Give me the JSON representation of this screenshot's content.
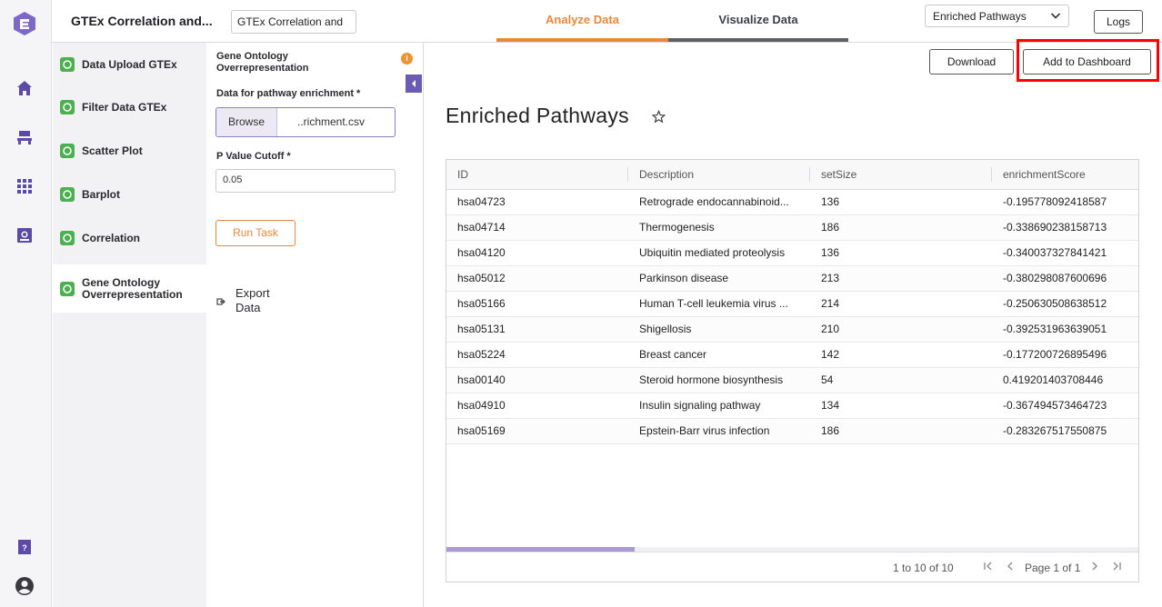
{
  "rail": {
    "icons": [
      "logo-icon",
      "home-icon",
      "workflow-icon",
      "apps-icon",
      "analysis-icon",
      "help-icon",
      "user-icon"
    ],
    "help_label": "?"
  },
  "header": {
    "app_title": "GTEx Correlation and...",
    "project_name": "GTEx Correlation and",
    "tabs": [
      {
        "label": "Analyze Data",
        "active": true
      },
      {
        "label": "Visualize Data",
        "active": false
      }
    ],
    "view_select": "Enriched Pathways",
    "logs_label": "Logs"
  },
  "steps": [
    {
      "label": "Data Upload GTEx",
      "done": true
    },
    {
      "label": "Filter Data GTEx",
      "done": true
    },
    {
      "label": "Scatter Plot",
      "done": true
    },
    {
      "label": "Barplot",
      "done": true
    },
    {
      "label": "Correlation",
      "done": true
    },
    {
      "label": "Gene Ontology Overrepresentation",
      "done": true,
      "active": true
    }
  ],
  "settings": {
    "title": "Gene Ontology Overrepresentation",
    "info_label": "i",
    "data_label": "Data for pathway enrichment *",
    "browse_label": "Browse",
    "file_name": "..richment.csv",
    "pvalue_label": "P Value Cutoff *",
    "pvalue_value": "0.05",
    "run_label": "Run Task",
    "export_label": "Export Data"
  },
  "main": {
    "download_label": "Download",
    "dashboard_label": "Add to Dashboard",
    "title": "Enriched Pathways",
    "columns": [
      "ID",
      "Description",
      "setSize",
      "enrichmentScore"
    ],
    "rows": [
      [
        "hsa04723",
        "Retrograde endocannabinoid...",
        "136",
        "-0.195778092418587"
      ],
      [
        "hsa04714",
        "Thermogenesis",
        "186",
        "-0.338690238158713"
      ],
      [
        "hsa04120",
        "Ubiquitin mediated proteolysis",
        "136",
        "-0.340037327841421"
      ],
      [
        "hsa05012",
        "Parkinson disease",
        "213",
        "-0.380298087600696"
      ],
      [
        "hsa05166",
        "Human T-cell leukemia virus ...",
        "214",
        "-0.250630508638512"
      ],
      [
        "hsa05131",
        "Shigellosis",
        "210",
        "-0.392531963639051"
      ],
      [
        "hsa05224",
        "Breast cancer",
        "142",
        "-0.177200726895496"
      ],
      [
        "hsa00140",
        "Steroid hormone biosynthesis",
        "54",
        "0.419201403708446"
      ],
      [
        "hsa04910",
        "Insulin signaling pathway",
        "134",
        "-0.367494573464723"
      ],
      [
        "hsa05169",
        "Epstein-Barr virus infection",
        "186",
        "-0.283267517550875"
      ]
    ],
    "range_text": "1 to 10 of 10",
    "page_text": "Page 1 of 1"
  },
  "colors": {
    "accent": "#e8883a",
    "brand": "#6c5bb3",
    "success": "#4caf50",
    "highlight": "#ff0000"
  }
}
